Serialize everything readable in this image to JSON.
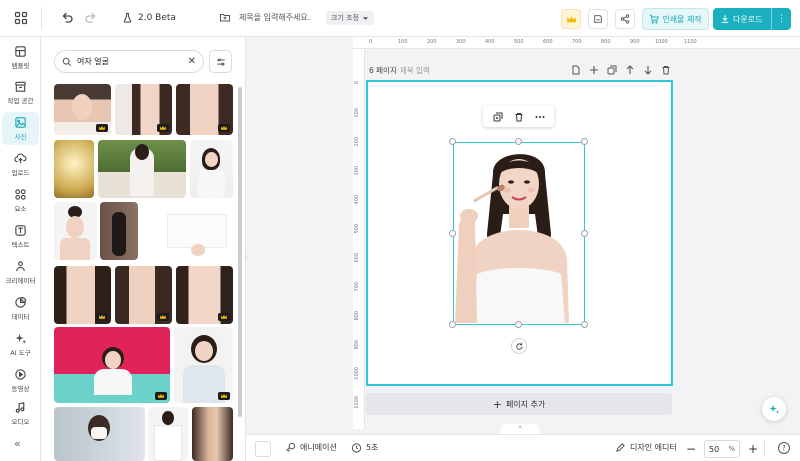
{
  "topbar": {
    "version": "2.0 Beta",
    "title_placeholder": "제목을 입력해주세요.",
    "size_label": "크기 조정",
    "print_label": "인쇄물 제작",
    "download_label": "다운로드"
  },
  "rail": {
    "items": [
      {
        "label": "템플릿",
        "icon": "template-icon"
      },
      {
        "label": "작업 공간",
        "icon": "workspace-icon"
      },
      {
        "label": "사진",
        "icon": "photo-icon",
        "active": true
      },
      {
        "label": "업로드",
        "icon": "upload-icon"
      },
      {
        "label": "요소",
        "icon": "elements-icon"
      },
      {
        "label": "텍스트",
        "icon": "text-icon"
      },
      {
        "label": "크리에이터",
        "icon": "creator-icon"
      },
      {
        "label": "데이터",
        "icon": "data-icon"
      },
      {
        "label": "AI 도구",
        "icon": "ai-tools-icon"
      },
      {
        "label": "동영상",
        "icon": "video-icon"
      },
      {
        "label": "오디오",
        "icon": "audio-icon"
      }
    ]
  },
  "panel": {
    "search_value": "여자 얼굴"
  },
  "ruler": {
    "top": [
      "0",
      "100",
      "200",
      "300",
      "400",
      "500",
      "600",
      "700",
      "800",
      "900",
      "1000",
      "1100"
    ],
    "left": [
      "0",
      "100",
      "200",
      "300",
      "400",
      "500",
      "600",
      "700",
      "800",
      "900",
      "1000",
      "1100"
    ]
  },
  "page": {
    "label": "6 페이지",
    "title_placeholder": "제목 입력",
    "add_label": "페이지 추가"
  },
  "bottombar": {
    "animation_label": "애니메이션",
    "duration_label": "5초",
    "design_editor_label": "디자인 에디터",
    "zoom_value": "50",
    "zoom_unit": "%",
    "help": "?"
  },
  "colors": {
    "accent": "#1ab0c0",
    "selection": "#31c8d6",
    "crown_badge": "#f2b705"
  }
}
